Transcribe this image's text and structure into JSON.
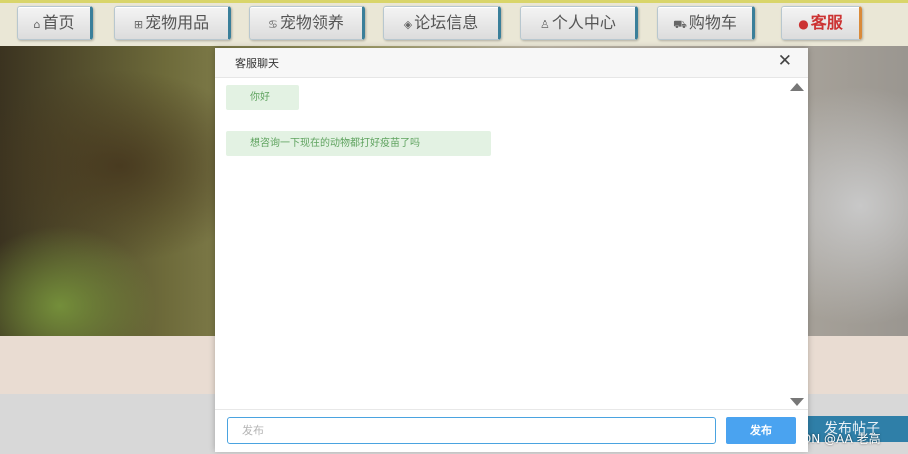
{
  "nav": {
    "items": [
      {
        "icon": "home-icon",
        "glyph": "⌂",
        "label": "首页"
      },
      {
        "icon": "gift-icon",
        "glyph": "⊞",
        "label": "宠物用品"
      },
      {
        "icon": "paw-icon",
        "glyph": "♋",
        "label": "宠物领养"
      },
      {
        "icon": "forum-icon",
        "glyph": "◈",
        "label": "论坛信息"
      },
      {
        "icon": "user-icon",
        "glyph": "♙",
        "label": "个人中心"
      },
      {
        "icon": "cart-icon",
        "glyph": "⛟",
        "label": "购物车"
      },
      {
        "icon": "service-icon",
        "glyph": "●",
        "label": "客服"
      }
    ],
    "active_index": 6,
    "colors": {
      "active": "#cc3333",
      "accent_border": "#3a7f9a"
    }
  },
  "background_page": {
    "post_button_label": "发布帖子",
    "watermark": "CSDN @AA 老高"
  },
  "chat": {
    "title": "客服聊天",
    "close_glyph": "✕",
    "messages": [
      {
        "text": "你好"
      },
      {
        "text": "想咨询一下现在的动物都打好疫苗了吗"
      }
    ],
    "input": {
      "value": "",
      "placeholder": "发布"
    },
    "send_label": "发布",
    "colors": {
      "message_bg": "#e3f2e3",
      "message_text": "#5fa35f",
      "send_bg": "#4aa3f0"
    }
  }
}
